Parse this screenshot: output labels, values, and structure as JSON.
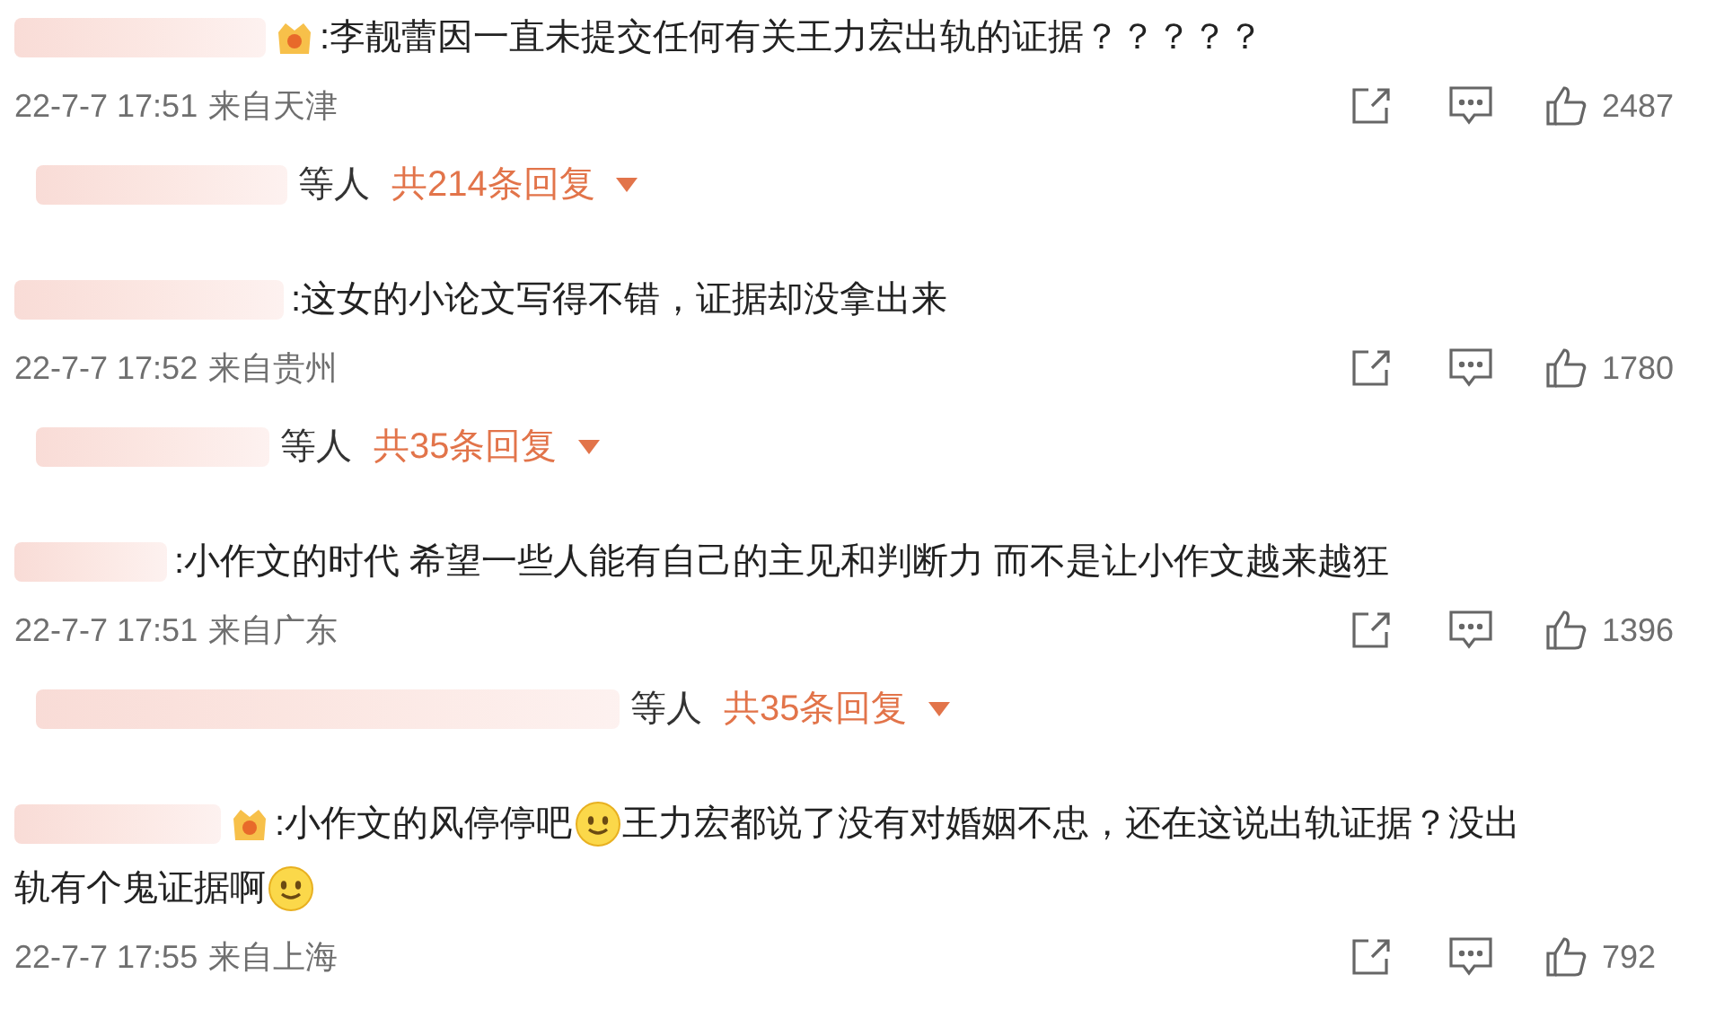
{
  "comments": [
    {
      "badge": true,
      "lines": [
        [
          {
            "kind": "text",
            "text": ":李靓蕾因一直未提交任何有关王力宏出轨的证据？？？？？"
          }
        ]
      ],
      "time": "22-7-7 17:51",
      "location": "来自天津",
      "likes": "2487",
      "replies": {
        "suffix": "等人",
        "count": "共214条回复"
      }
    },
    {
      "badge": false,
      "lines": [
        [
          {
            "kind": "text",
            "text": ":这女的小论文写得不错，证据却没拿出来"
          }
        ]
      ],
      "time": "22-7-7 17:52",
      "location": "来自贵州",
      "likes": "1780",
      "replies": {
        "suffix": "等人",
        "count": "共35条回复"
      }
    },
    {
      "badge": false,
      "lines": [
        [
          {
            "kind": "text",
            "text": ":小作文的时代 希望一些人能有自己的主见和判断力 而不是让小作文越来越狂"
          }
        ]
      ],
      "time": "22-7-7 17:51",
      "location": "来自广东",
      "likes": "1396",
      "replies": {
        "suffix": "等人",
        "count": "共35条回复"
      }
    },
    {
      "badge": true,
      "lines": [
        [
          {
            "kind": "text",
            "text": ":小作文的风停停吧"
          },
          {
            "kind": "emoji"
          },
          {
            "kind": "text",
            "text": "王力宏都说了没有对婚姻不忠，还在这说出轨证据？没出"
          }
        ],
        [
          {
            "kind": "text",
            "text": "轨有个鬼证据啊"
          },
          {
            "kind": "emoji"
          }
        ]
      ],
      "time": "22-7-7 17:55",
      "location": "来自上海",
      "likes": "792"
    }
  ]
}
